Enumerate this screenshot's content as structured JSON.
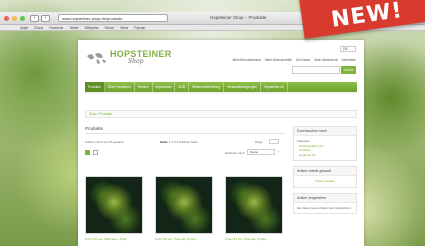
{
  "browser": {
    "url": "www.hopsteiner-shop.de/produkte",
    "window_title": "Hopsteiner Shop – Produkte",
    "bookmarks": [
      "Apple",
      "iCloud",
      "Facebook",
      "Twitter",
      "Wikipedia",
      "Yahoo!",
      "News",
      "Popular"
    ]
  },
  "badge": {
    "text": "NEW!",
    "color": "#d83a2e"
  },
  "site": {
    "logo": {
      "main": "HOPSTEINER",
      "sub": "Shop"
    },
    "lang": "DE",
    "top_links": [
      "Mein Benutzerkonto",
      "Mein Wunschzettel",
      "Zur Kasse",
      "Mein Warenkorb",
      "Anmelden"
    ],
    "search_button": "Suche",
    "nav": [
      "Produkte",
      "Über Hopsteiner",
      "Service",
      "Impressum",
      "AGB",
      "Widerrufsbelehrung",
      "Versandbedingungen",
      "Hopsteiner.de"
    ],
    "breadcrumb": {
      "home": "Shop",
      "current": "Produkte"
    },
    "accent": "#7fb33a"
  },
  "content": {
    "heading": "Produkte",
    "count_text": "Artikel 1 bis 9 von 36 gesamt",
    "pager_label": "Seite:",
    "pages": "1 2 3 4",
    "pager_next": "Nächste Seite",
    "show_label": "Zeige",
    "sort_label": "Sortieren nach",
    "sort_value": "Name",
    "products": [
      {
        "name": "Pellet 45 aus Hallertauer Hopf"
      },
      {
        "name": "Pellet 90 aus Hallertau Hopfen"
      },
      {
        "name": "Pellet 45 aus Hallertau Hopfen"
      }
    ]
  },
  "sidebar": {
    "filter_title": "Durchsuchen nach",
    "filter_category": "Kategorie",
    "filter_items": [
      "Hopfenpellets (36)",
      "CO2-Ext",
      "Hopfenöl (8)"
    ],
    "recent_title": "Artikel zuletzt gekauft",
    "recent_link": "Zuletzt gekauft",
    "compare_title": "Artikel vergleichen",
    "compare_text": "Sie haben keine Artikel zum Vergleichen."
  }
}
